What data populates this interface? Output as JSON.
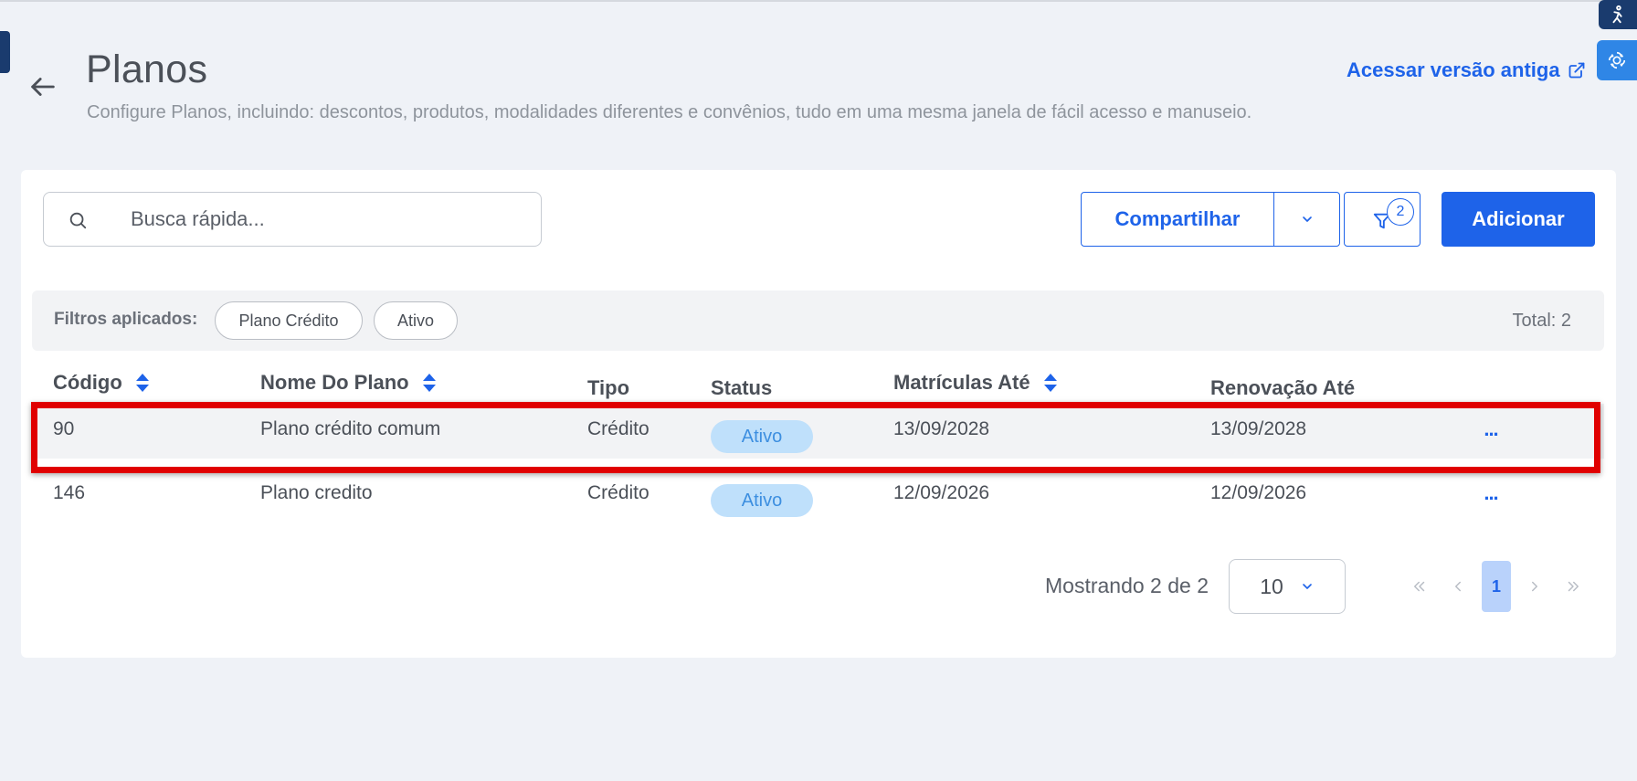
{
  "header": {
    "title": "Planos",
    "subtitle": "Configure Planos, incluindo: descontos, produtos, modalidades diferentes e convênios, tudo em uma mesma janela de fácil acesso e manuseio.",
    "old_version_link": "Acessar versão antiga"
  },
  "toolbar": {
    "search_placeholder": "Busca rápida...",
    "share_label": "Compartilhar",
    "filter_count": "2",
    "add_label": "Adicionar"
  },
  "filters": {
    "label": "Filtros aplicados:",
    "chips": [
      "Plano Crédito",
      "Ativo"
    ],
    "total": "Total: 2"
  },
  "table": {
    "columns": [
      "Código",
      "Nome Do Plano",
      "Tipo",
      "Status",
      "Matrículas Até",
      "Renovação Até"
    ],
    "rows": [
      {
        "codigo": "90",
        "nome": "Plano crédito comum",
        "tipo": "Crédito",
        "status": "Ativo",
        "matriculas_ate": "13/09/2028",
        "renovacao_ate": "13/09/2028",
        "actions": "..."
      },
      {
        "codigo": "146",
        "nome": "Plano credito",
        "tipo": "Crédito",
        "status": "Ativo",
        "matriculas_ate": "12/09/2026",
        "renovacao_ate": "12/09/2026",
        "actions": "..."
      }
    ]
  },
  "pagination": {
    "showing": "Mostrando 2 de 2",
    "page_size": "10",
    "current_page": "1"
  },
  "colors": {
    "accent": "#1e63e9",
    "badge_bg": "#bfe0fb",
    "highlight": "#e00000"
  },
  "icons": {
    "back": "arrow-left-icon",
    "external": "external-link-icon",
    "search": "search-icon",
    "filter": "filter-icon",
    "chevron": "chevron-down-icon",
    "accessibility": "accessibility-icon",
    "assistant": "assistant-icon"
  }
}
